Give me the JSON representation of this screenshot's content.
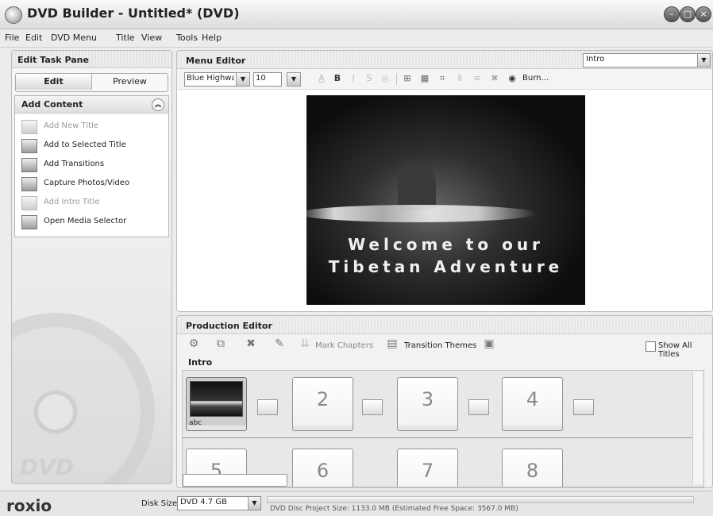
{
  "window": {
    "title": "DVD Builder - Untitled* (DVD)"
  },
  "menubar": [
    "File",
    "Edit",
    "DVD Menu",
    "Title",
    "View",
    "Tools",
    "Help"
  ],
  "left_pane": {
    "title": "Edit Task Pane",
    "tabs": [
      "Edit",
      "Preview"
    ],
    "add_content": {
      "title": "Add Content",
      "items": [
        {
          "label": "Add New Title",
          "enabled": false
        },
        {
          "label": "Add to Selected Title",
          "enabled": true
        },
        {
          "label": "Add Transitions",
          "enabled": true
        },
        {
          "label": "Capture Photos/Video",
          "enabled": true
        },
        {
          "label": "Add Intro Title",
          "enabled": false
        },
        {
          "label": "Open Media Selector",
          "enabled": true
        }
      ]
    },
    "disc_watermark": "DVD"
  },
  "menu_editor": {
    "title": "Menu Editor",
    "selected_menu": "Intro",
    "font_family": "Blue Highway C",
    "font_size": "10",
    "burn_label": "Burn...",
    "preview_text_line1": "Welcome to our",
    "preview_text_line2": "Tibetan Adventure"
  },
  "production_editor": {
    "title": "Production Editor",
    "mark_chapters_label": "Mark Chapters",
    "transition_themes_label": "Transition Themes",
    "show_all_titles_label": "Show All Titles",
    "section_label": "Intro",
    "clip_label": "abc",
    "slot_numbers": [
      "2",
      "3",
      "4",
      "5",
      "6",
      "7",
      "8"
    ]
  },
  "statusbar": {
    "brand": "roxio",
    "disk_size_label": "Disk Size",
    "disk_size_value": "DVD 4.7 GB",
    "status_text": "DVD Disc Project Size: 1133.0 MB (Estimated Free Space: 3567.0 MB)"
  }
}
